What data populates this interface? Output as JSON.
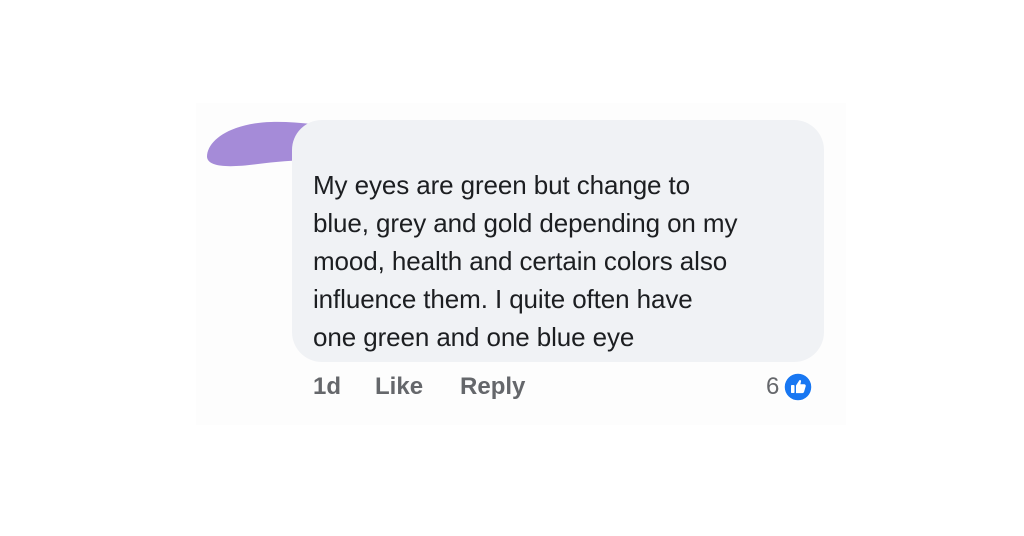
{
  "comment": {
    "author_redaction_color": "#a58bd8",
    "text": "My eyes are green but change to\nblue, grey and gold depending on my\nmood, health and certain colors also\ninfluence them.  I quite often have\none green and one blue eye",
    "bubble_color": "#f0f2f5"
  },
  "actions": {
    "timestamp": "1d",
    "like_label": "Like",
    "reply_label": "Reply"
  },
  "reactions": {
    "count": "6",
    "icon": "thumbs-up-icon",
    "badge_color": "#1877f2"
  }
}
